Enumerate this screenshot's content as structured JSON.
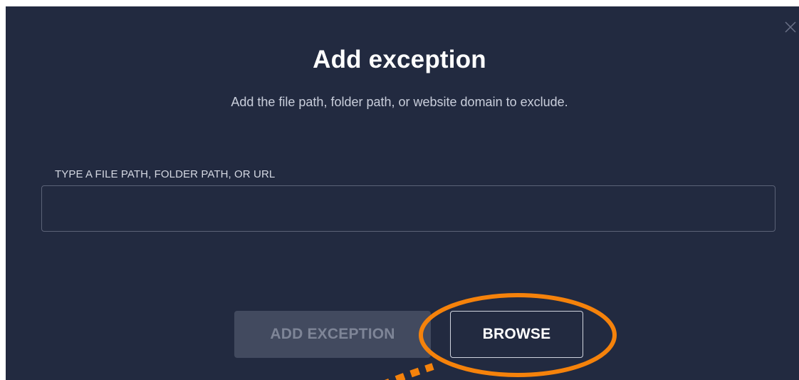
{
  "dialog": {
    "title": "Add exception",
    "subtitle": "Add the file path, folder path, or website domain to exclude.",
    "close_icon": "close-icon"
  },
  "form": {
    "field_label": "TYPE A FILE PATH, FOLDER PATH, OR URL",
    "field_value": ""
  },
  "actions": {
    "add_exception_label": "ADD EXCEPTION",
    "browse_label": "BROWSE"
  },
  "colors": {
    "dialog_background": "#222a40",
    "disabled_button": "#424a5f",
    "highlight_annotation": "#f5820b"
  }
}
